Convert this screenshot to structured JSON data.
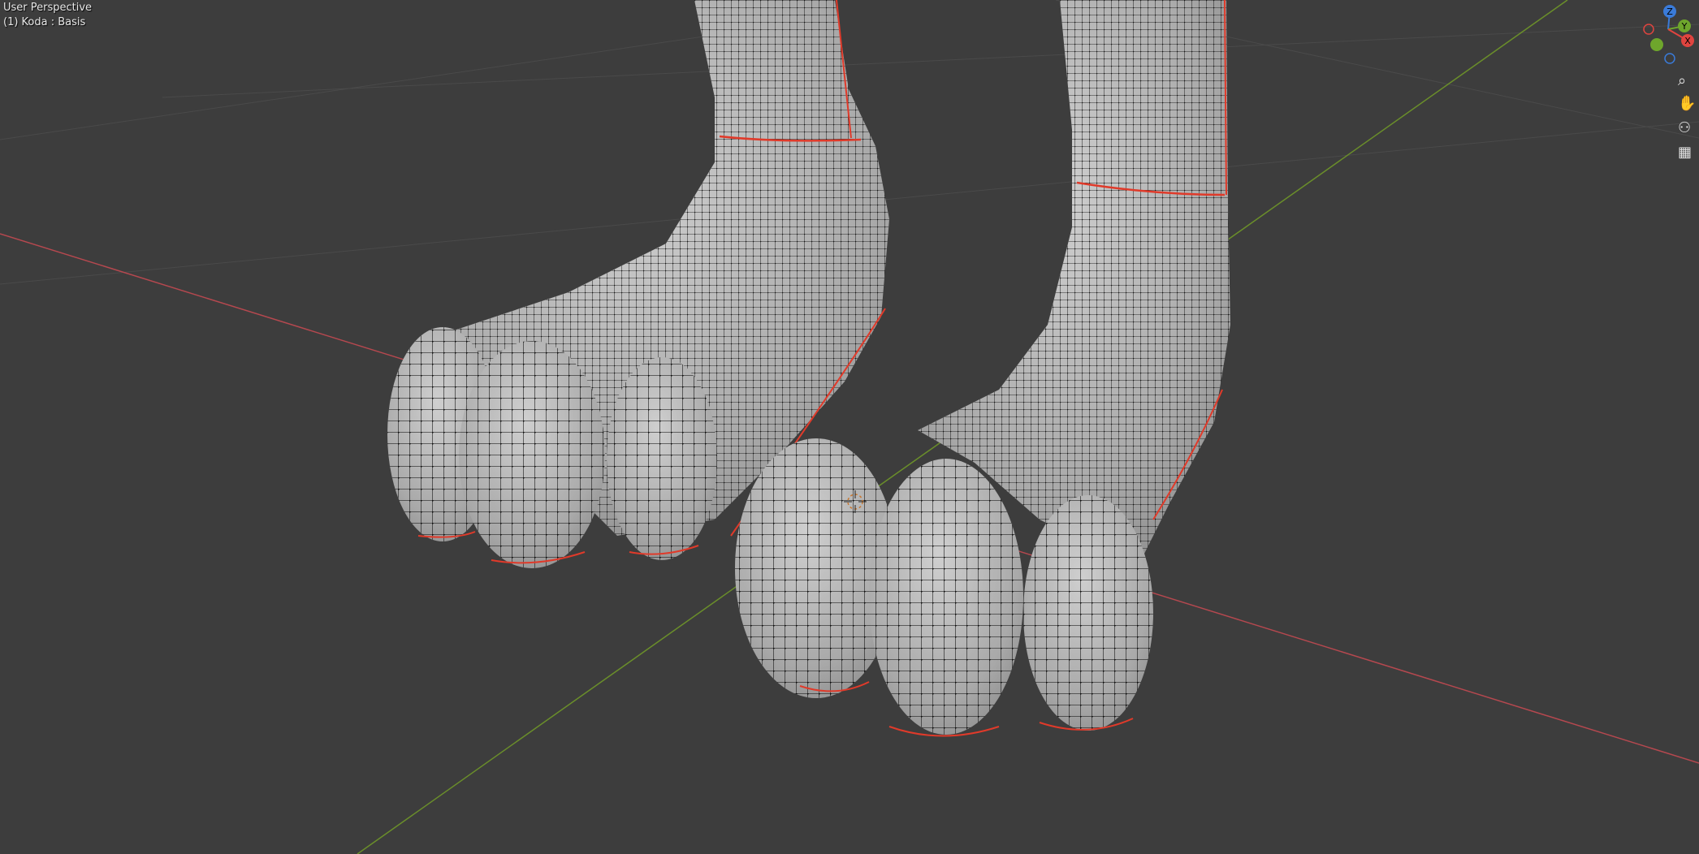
{
  "viewport": {
    "view_name": "User Perspective",
    "object_name": "(1) Koda : Basis",
    "colors": {
      "background": "#3d3d3d",
      "grid": "#4a4a4a",
      "x_axis": "#b5484f",
      "y_axis": "#6a8e2a",
      "seam": "#e03a2a",
      "mesh_fill": "#b8b8b8",
      "wire": "#111111"
    }
  },
  "gizmo": {
    "z_label": "Z",
    "y_label": "Y",
    "x_label": "X",
    "colors": {
      "x": "#e0443f",
      "y": "#6ea62c",
      "z": "#3a7bd9"
    }
  },
  "nav_buttons": [
    {
      "icon": "zoom-icon",
      "glyph": "⌕"
    },
    {
      "icon": "pan-hand-icon",
      "glyph": "✋"
    },
    {
      "icon": "camera-icon",
      "glyph": "⚇"
    },
    {
      "icon": "grid-perspective-icon",
      "glyph": "▦"
    }
  ]
}
